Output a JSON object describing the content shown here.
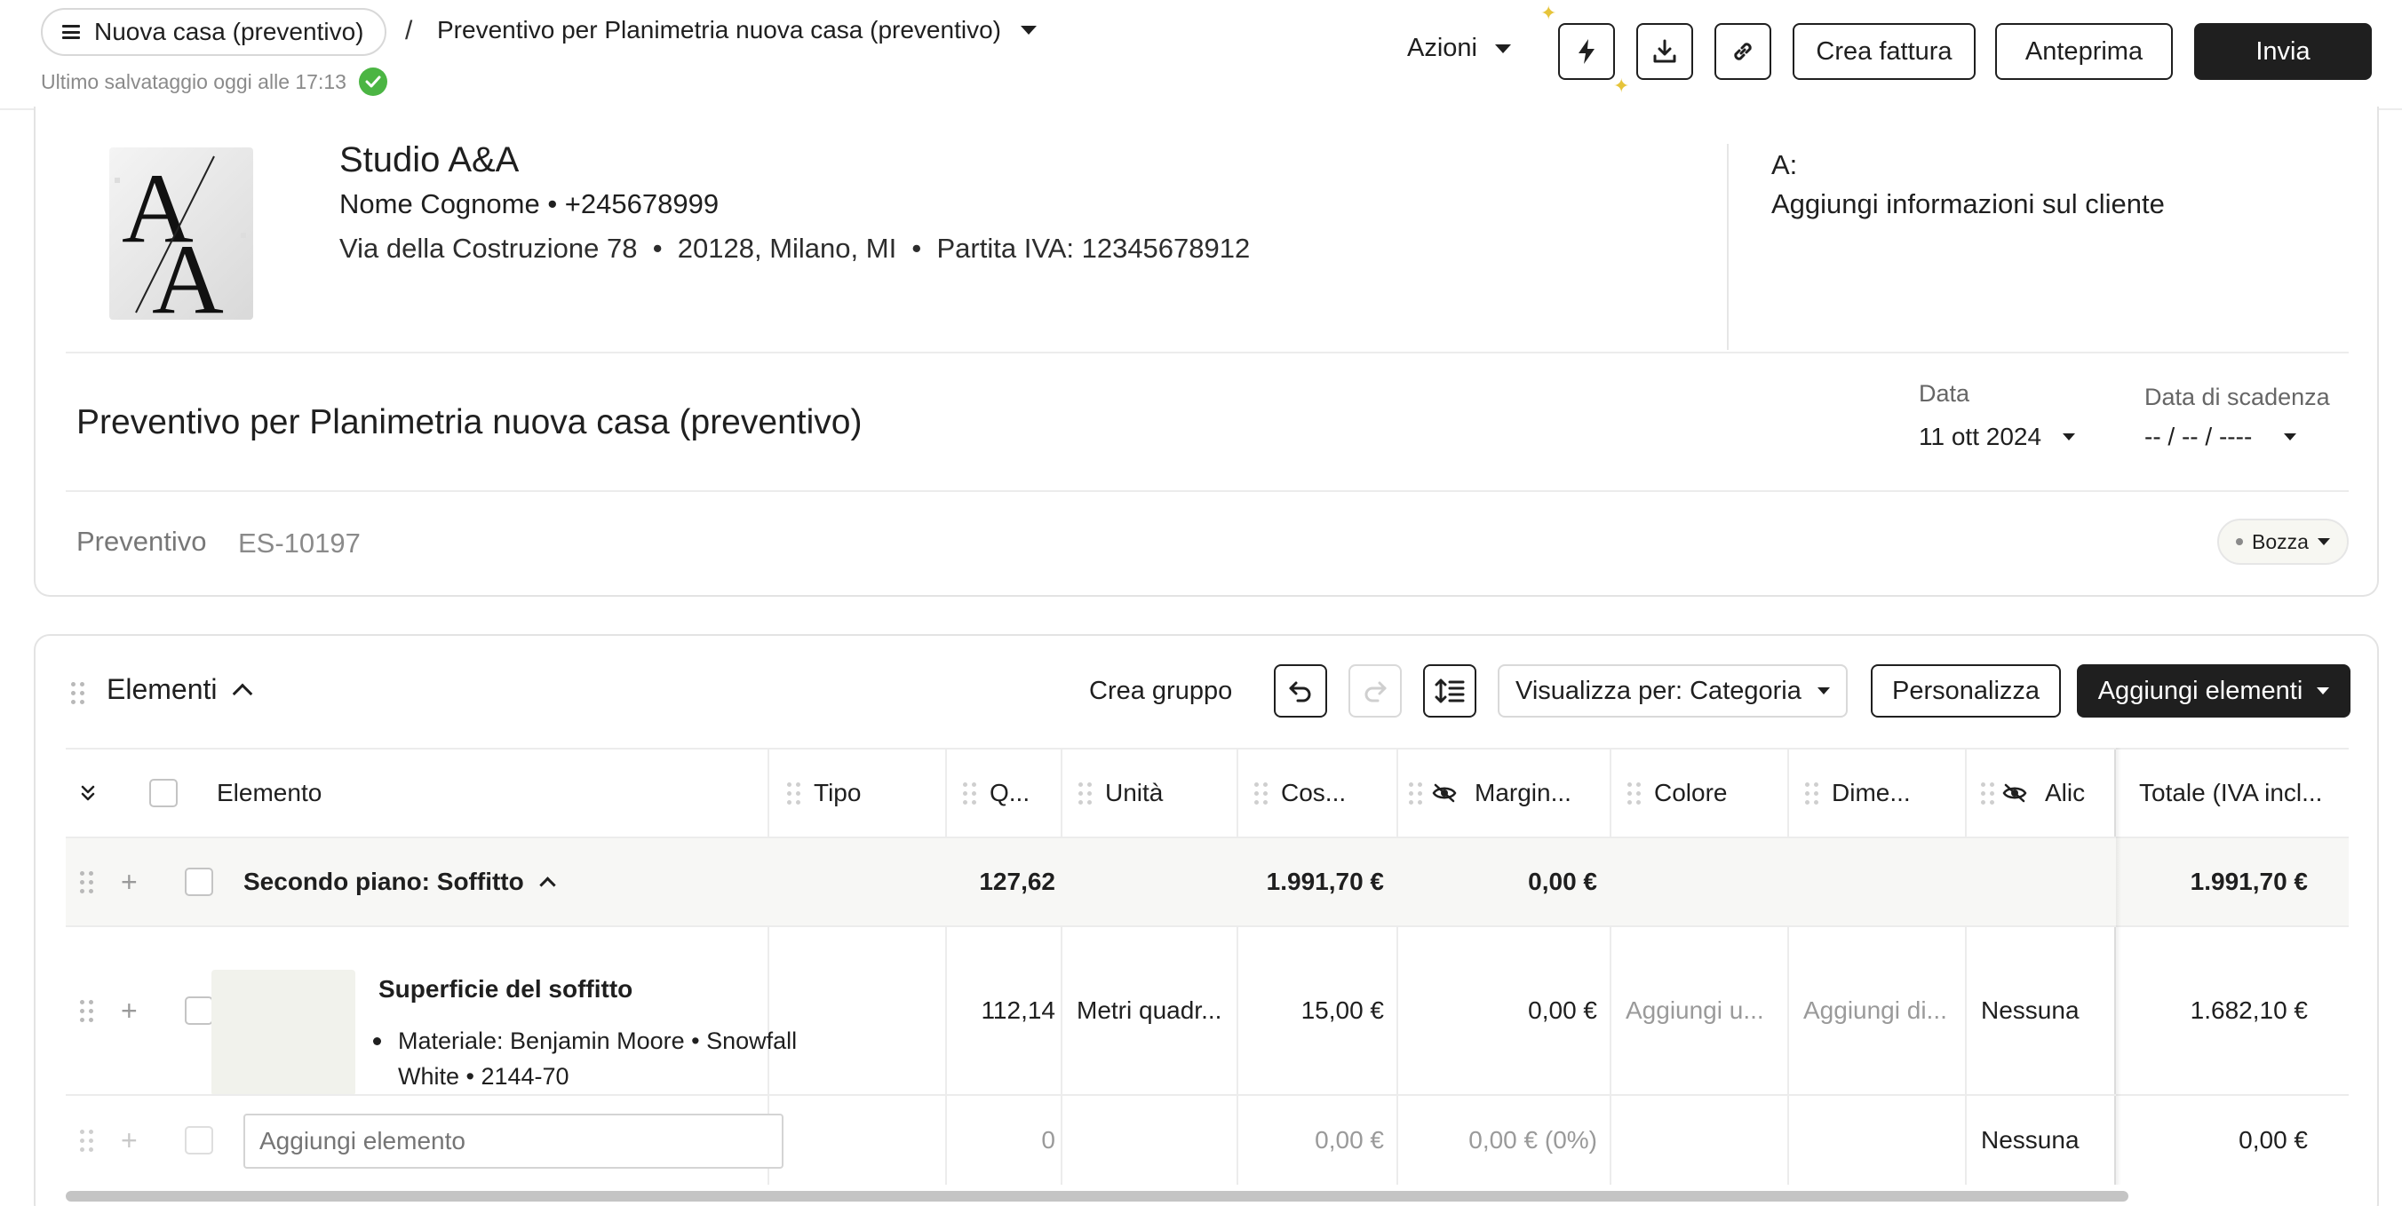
{
  "header": {
    "project_name": "Nuova casa (preventivo)",
    "separator": "/",
    "document_title": "Preventivo per Planimetria nuova casa (preventivo)",
    "save_status": "Ultimo salvataggio oggi alle 17:13",
    "actions_label": "Azioni",
    "create_invoice_label": "Crea fattura",
    "preview_label": "Anteprima",
    "send_label": "Invia"
  },
  "company": {
    "name": "Studio A&A",
    "contact": "Nome Cognome  •  +245678999",
    "address": "Via della Costruzione 78  •  20128, Milano, MI  •  Partita IVA: 12345678912",
    "logo_text_top": "A",
    "logo_text_bottom": "A"
  },
  "client": {
    "label": "A:",
    "add_info": "Aggiungi informazioni sul cliente"
  },
  "document": {
    "title": "Preventivo per Planimetria nuova casa (preventivo)",
    "date_label": "Data",
    "date_value": "11 ott 2024",
    "due_date_label": "Data di scadenza",
    "due_date_value": "-- / -- / ----",
    "quote_label": "Preventivo",
    "quote_number": "ES-10197",
    "status": "Bozza"
  },
  "elements": {
    "title": "Elementi",
    "create_group": "Crea gruppo",
    "view_by": "Visualizza per: Categoria",
    "customize": "Personalizza",
    "add_items": "Aggiungi elementi",
    "columns": {
      "element": "Elemento",
      "type": "Tipo",
      "qty": "Q...",
      "unit": "Unità",
      "cost": "Cos...",
      "margin": "Margin...",
      "color": "Colore",
      "dimensions": "Dime...",
      "tax_rate": "Alic",
      "total": "Totale (IVA incl..."
    },
    "group": {
      "name": "Secondo piano: Soffitto",
      "qty": "127,62",
      "cost": "1.991,70 €",
      "margin": "0,00 €",
      "total": "1.991,70 €"
    },
    "item": {
      "name": "Superficie del soffitto",
      "description": "Materiale: Benjamin Moore • Snowfall White • 2144-70",
      "qty": "112,14",
      "unit": "Metri quadr...",
      "cost": "15,00 €",
      "margin": "0,00 €",
      "color": "Aggiungi u...",
      "dimensions": "Aggiungi di...",
      "tax_rate": "Nessuna",
      "total": "1.682,10 €"
    },
    "new_row": {
      "placeholder": "Aggiungi elemento",
      "qty": "0",
      "cost": "0,00 €",
      "margin": "0,00 € (0%)",
      "tax_rate": "Nessuna",
      "total": "0,00 €"
    }
  },
  "colors": {
    "primary_dark": "#1f1f1f",
    "success": "#4bb543",
    "sparkle": "#e6c43a",
    "group_row_bg": "#f7f7f5"
  }
}
